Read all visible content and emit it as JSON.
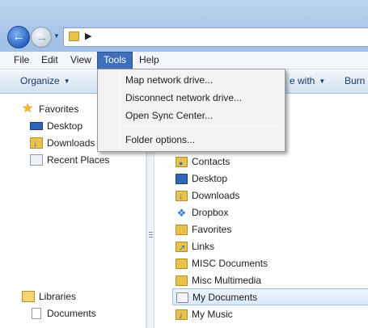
{
  "menubar": {
    "items": [
      {
        "label": "File",
        "active": false
      },
      {
        "label": "Edit",
        "active": false
      },
      {
        "label": "View",
        "active": false
      },
      {
        "label": "Tools",
        "active": true
      },
      {
        "label": "Help",
        "active": false
      }
    ]
  },
  "toolbar": {
    "organize": "Organize",
    "share_with": "e with",
    "burn": "Burn"
  },
  "tools_menu": {
    "items": [
      "Map network drive...",
      "Disconnect network drive...",
      "Open Sync Center...",
      "Folder options..."
    ]
  },
  "navpane": {
    "favorites": {
      "header": "Favorites",
      "items": [
        "Desktop",
        "Downloads",
        "Recent Places"
      ]
    },
    "libraries": {
      "header": "Libraries",
      "items": [
        "Documents"
      ]
    }
  },
  "content": {
    "items": [
      "Contacts",
      "Desktop",
      "Downloads",
      "Dropbox",
      "Favorites",
      "Links",
      "MISC Documents",
      "Misc Multimedia",
      "My Documents",
      "My Music"
    ],
    "selected": "My Documents"
  },
  "colors": {
    "menu_highlight": "#3f6fb8",
    "selection": "#d9e9fb"
  }
}
